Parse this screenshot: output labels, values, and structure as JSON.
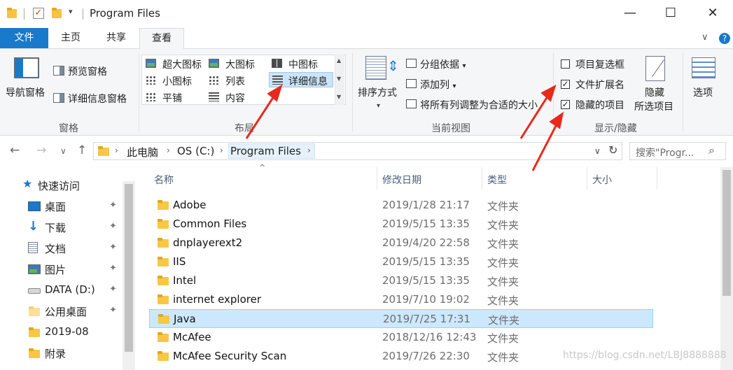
{
  "window": {
    "title": "Program Files",
    "minimize": "—",
    "maximize": "☐",
    "close": "✕",
    "qa_arrow": "▾",
    "check": "✓"
  },
  "ribbon_tabs": {
    "file": "文件",
    "home": "主页",
    "share": "共享",
    "view": "查看",
    "collapse": "∨",
    "help": "?"
  },
  "ribbon": {
    "panes": {
      "nav_pane": "导航窗格",
      "preview_pane": "预览窗格",
      "details_pane": "详细信息窗格",
      "label": "窗格"
    },
    "layout": {
      "items": [
        "超大图标",
        "大图标",
        "中图标",
        "小图标",
        "列表",
        "详细信息",
        "平铺",
        "内容"
      ],
      "label": "布局"
    },
    "current_view": {
      "sort_by": "排序方式",
      "group_by": "分组依据",
      "add_column": "添加列",
      "size_all": "将所有列调整为合适的大小",
      "label": "当前视图"
    },
    "show_hide": {
      "item_checkboxes": {
        "label": "项目复选框",
        "checked": false
      },
      "extensions": {
        "label": "文件扩展名",
        "checked": true
      },
      "hidden_items": {
        "label": "隐藏的项目",
        "checked": true
      },
      "hide_selected_1": "隐藏",
      "hide_selected_2": "所选项目",
      "label": "显示/隐藏"
    },
    "options": "选项"
  },
  "address": {
    "crumbs": [
      "此电脑",
      "OS (C:)",
      "Program Files"
    ],
    "search_placeholder": "搜索\"Progr...",
    "back": "←",
    "forward": "→",
    "recent": "∨",
    "up": "↑",
    "dropdown": "∨",
    "refresh": "↻",
    "sep": "›",
    "search_icon": "⌕"
  },
  "nav_pane": {
    "quick_access": "快速访问",
    "items": [
      {
        "label": "桌面",
        "icon": "desktop-icon",
        "pinned": true
      },
      {
        "label": "下载",
        "icon": "download-icon",
        "pinned": true
      },
      {
        "label": "文档",
        "icon": "document-icon",
        "pinned": true
      },
      {
        "label": "图片",
        "icon": "picture-icon",
        "pinned": true
      },
      {
        "label": "DATA (D:)",
        "icon": "drive-icon",
        "pinned": true
      },
      {
        "label": "公用桌面",
        "icon": "folder-icon",
        "pinned": true
      },
      {
        "label": "2019-08",
        "icon": "folder-icon",
        "pinned": false
      },
      {
        "label": "附录",
        "icon": "folder-icon",
        "pinned": false
      }
    ],
    "pin_glyph": "📌",
    "star_glyph": "★"
  },
  "files": {
    "columns": [
      "名称",
      "修改日期",
      "类型",
      "大小"
    ],
    "sort_glyph": "^",
    "rows": [
      {
        "name": "Adobe",
        "date": "2019/1/28 21:17",
        "type": "文件夹"
      },
      {
        "name": "Common Files",
        "date": "2019/5/15 13:35",
        "type": "文件夹"
      },
      {
        "name": "dnplayerext2",
        "date": "2019/4/20 22:58",
        "type": "文件夹"
      },
      {
        "name": "IIS",
        "date": "2019/5/15 13:35",
        "type": "文件夹"
      },
      {
        "name": "Intel",
        "date": "2019/5/15 13:35",
        "type": "文件夹"
      },
      {
        "name": "internet explorer",
        "date": "2019/7/10 19:02",
        "type": "文件夹"
      },
      {
        "name": "Java",
        "date": "2019/7/25 17:31",
        "type": "文件夹",
        "selected": true
      },
      {
        "name": "McAfee",
        "date": "2018/12/16 12:43",
        "type": "文件夹"
      },
      {
        "name": "McAfee Security Scan",
        "date": "2019/7/26 22:30",
        "type": "文件夹"
      }
    ]
  },
  "watermark": "https://blog.csdn.net/LBJ8888888",
  "colors": {
    "accent": "#1979ca",
    "selection": "#cce8ff",
    "annotation": "#e8291c"
  }
}
